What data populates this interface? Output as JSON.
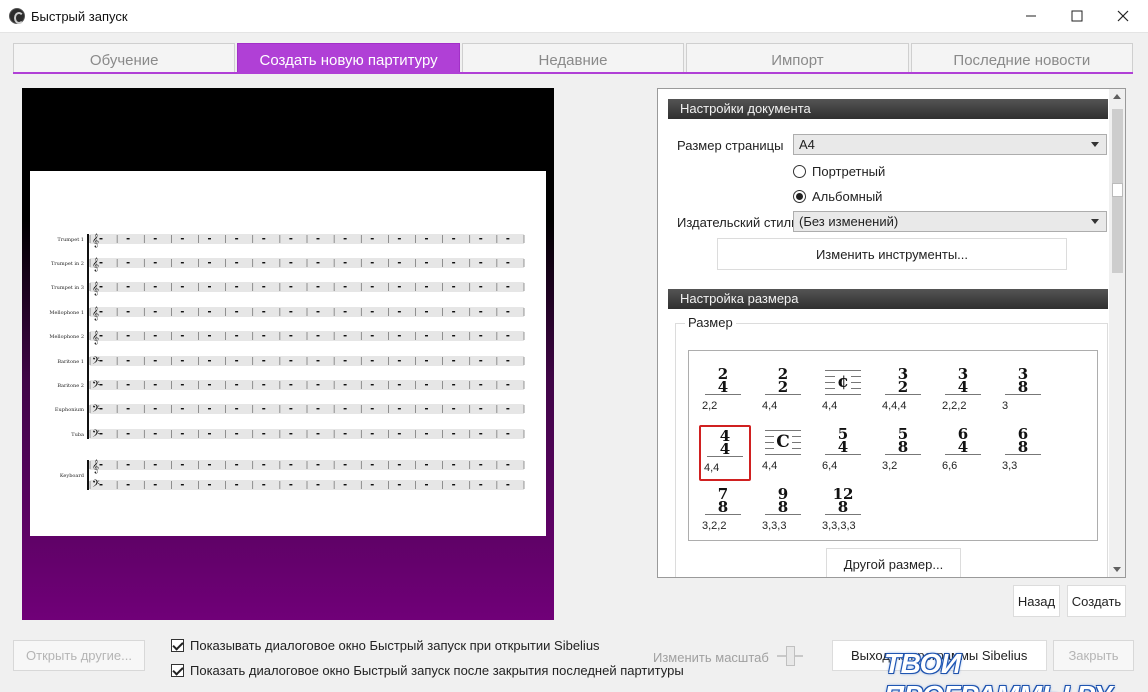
{
  "window": {
    "title": "Быстрый запуск",
    "minimize_icon": "minimize-icon",
    "maximize_icon": "maximize-icon",
    "close_icon": "close-icon"
  },
  "tabs": [
    {
      "label": "Обучение",
      "active": false
    },
    {
      "label": "Создать новую партитуру",
      "active": true
    },
    {
      "label": "Недавние",
      "active": false
    },
    {
      "label": "Импорт",
      "active": false
    },
    {
      "label": "Последние новости",
      "active": false
    }
  ],
  "preview": {
    "instruments": [
      "Trumpet 1",
      "Trumpet in 2",
      "Trumpet in 3",
      "Mellophone 1",
      "Mellophone 2",
      "Baritone 1",
      "Baritone 2",
      "Euphonium",
      "Tuba",
      "Keyboard"
    ]
  },
  "document_settings": {
    "header": "Настройки документа",
    "page_size_label": "Размер страницы",
    "page_size_value": "A4",
    "portrait_label": "Портретный",
    "landscape_label": "Альбомный",
    "orientation": "landscape",
    "house_style_label": "Издательский стиль",
    "house_style_value": "(Без изменений)",
    "change_instruments_button": "Изменить инструменты..."
  },
  "time_signature": {
    "header": "Настройка размера",
    "group_label": "Размер",
    "items": [
      {
        "top": "2",
        "bottom": "4",
        "beaming": "2,2",
        "selected": false
      },
      {
        "top": "2",
        "bottom": "2",
        "beaming": "4,4",
        "selected": false
      },
      {
        "symbol": "¢",
        "beaming": "4,4",
        "selected": false
      },
      {
        "top": "3",
        "bottom": "2",
        "beaming": "4,4,4",
        "selected": false
      },
      {
        "top": "3",
        "bottom": "4",
        "beaming": "2,2,2",
        "selected": false
      },
      {
        "top": "3",
        "bottom": "8",
        "beaming": "3",
        "selected": false
      },
      {
        "top": "4",
        "bottom": "4",
        "beaming": "4,4",
        "selected": true
      },
      {
        "symbol": "C",
        "beaming": "4,4",
        "selected": false
      },
      {
        "top": "5",
        "bottom": "4",
        "beaming": "6,4",
        "selected": false
      },
      {
        "top": "5",
        "bottom": "8",
        "beaming": "3,2",
        "selected": false
      },
      {
        "top": "6",
        "bottom": "4",
        "beaming": "6,6",
        "selected": false
      },
      {
        "top": "6",
        "bottom": "8",
        "beaming": "3,3",
        "selected": false
      },
      {
        "top": "7",
        "bottom": "8",
        "beaming": "3,2,2",
        "selected": false
      },
      {
        "top": "9",
        "bottom": "8",
        "beaming": "3,3,3",
        "selected": false
      },
      {
        "top": "12",
        "bottom": "8",
        "beaming": "3,3,3,3",
        "selected": false
      }
    ],
    "other_button": "Другой размер..."
  },
  "buttons": {
    "back": "Назад",
    "create": "Создать",
    "open_other": "Открыть другие...",
    "exit": "Выход из программы Sibelius",
    "close": "Закрыть"
  },
  "footer": {
    "show_on_start": "Показывать диалоговое окно Быстрый запуск при открытии Sibelius",
    "show_on_close": "Показать диалоговое окно Быстрый запуск после закрытия последней партитуры",
    "show_on_start_checked": true,
    "show_on_close_checked": true,
    "zoom_label": "Изменить масштаб"
  },
  "watermark": "ТВОИ ПРОГРАММЫ РУ",
  "colors": {
    "accent": "#b040d6",
    "selection": "#d02020"
  }
}
